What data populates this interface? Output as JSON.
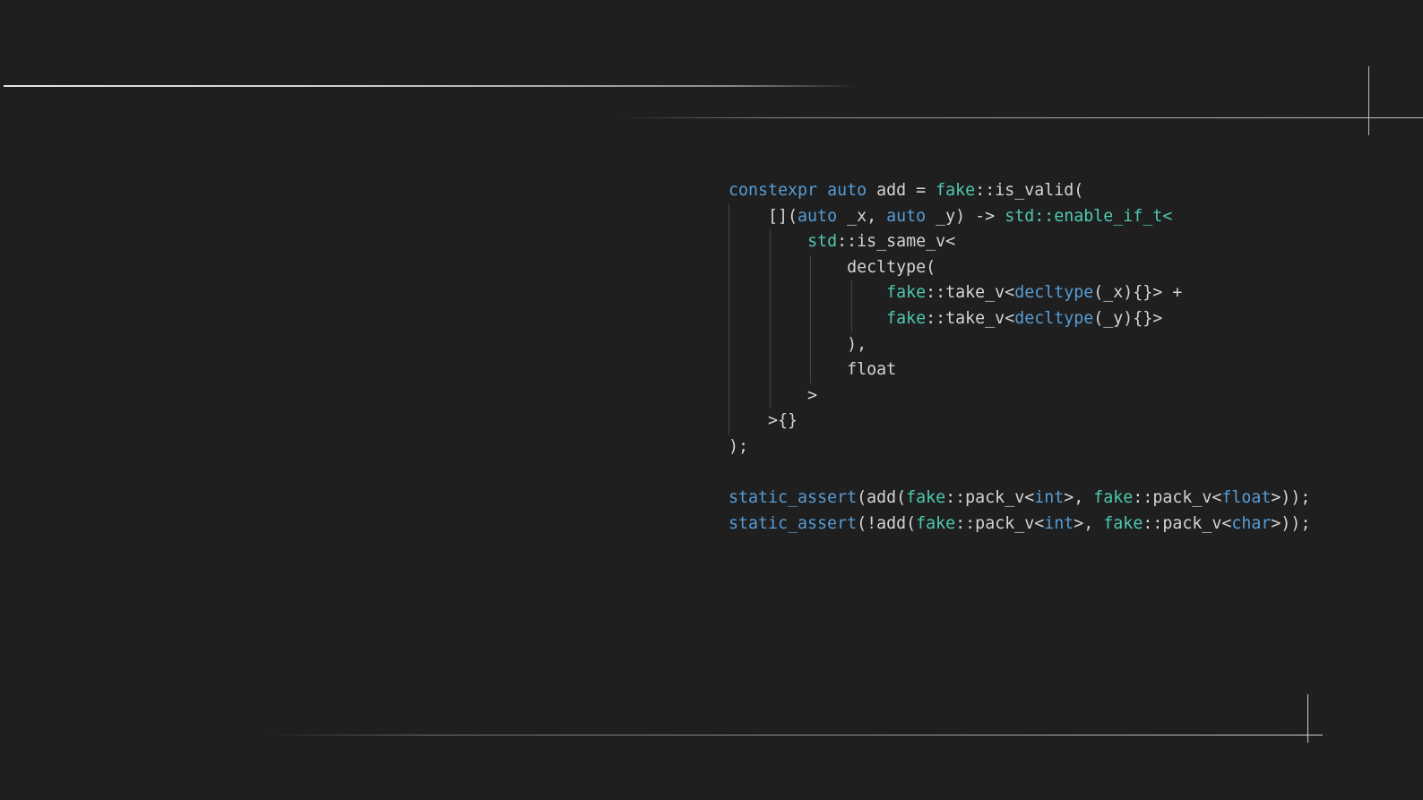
{
  "code_lines": [
    [
      {
        "t": "constexpr",
        "c": "kw"
      },
      {
        "t": " ",
        "c": "pl"
      },
      {
        "t": "auto",
        "c": "kw"
      },
      {
        "t": " add = ",
        "c": "pl"
      },
      {
        "t": "fake",
        "c": "ns"
      },
      {
        "t": "::is_valid(",
        "c": "pl"
      }
    ],
    [
      {
        "t": "    [](",
        "c": "pl"
      },
      {
        "t": "auto",
        "c": "kw"
      },
      {
        "t": " _x, ",
        "c": "pl"
      },
      {
        "t": "auto",
        "c": "kw"
      },
      {
        "t": " _y) -> ",
        "c": "pl"
      },
      {
        "t": "std::enable_if_t<",
        "c": "ns"
      }
    ],
    [
      {
        "t": "        ",
        "c": "pl"
      },
      {
        "t": "std",
        "c": "ns"
      },
      {
        "t": "::is_same_v<",
        "c": "pl"
      }
    ],
    [
      {
        "t": "            decltype(",
        "c": "pl"
      }
    ],
    [
      {
        "t": "                ",
        "c": "pl"
      },
      {
        "t": "fake",
        "c": "ns"
      },
      {
        "t": "::take_v<",
        "c": "pl"
      },
      {
        "t": "decltype",
        "c": "kw"
      },
      {
        "t": "(_x){}> +",
        "c": "pl"
      }
    ],
    [
      {
        "t": "                ",
        "c": "pl"
      },
      {
        "t": "fake",
        "c": "ns"
      },
      {
        "t": "::take_v<",
        "c": "pl"
      },
      {
        "t": "decltype",
        "c": "kw"
      },
      {
        "t": "(_y){}>",
        "c": "pl"
      }
    ],
    [
      {
        "t": "            ),",
        "c": "pl"
      }
    ],
    [
      {
        "t": "            float",
        "c": "pl"
      }
    ],
    [
      {
        "t": "        >",
        "c": "pl"
      }
    ],
    [
      {
        "t": "    >{}",
        "c": "pl"
      }
    ],
    [
      {
        "t": ");",
        "c": "pl"
      }
    ],
    [
      {
        "t": "",
        "c": "pl"
      }
    ],
    [
      {
        "t": "static_assert",
        "c": "kw"
      },
      {
        "t": "(add(",
        "c": "pl"
      },
      {
        "t": "fake",
        "c": "ns"
      },
      {
        "t": "::pack_v<",
        "c": "pl"
      },
      {
        "t": "int",
        "c": "kw"
      },
      {
        "t": ">, ",
        "c": "pl"
      },
      {
        "t": "fake",
        "c": "ns"
      },
      {
        "t": "::pack_v<",
        "c": "pl"
      },
      {
        "t": "float",
        "c": "kw"
      },
      {
        "t": ">));",
        "c": "pl"
      }
    ],
    [
      {
        "t": "static_assert",
        "c": "kw"
      },
      {
        "t": "(!add(",
        "c": "pl"
      },
      {
        "t": "fake",
        "c": "ns"
      },
      {
        "t": "::pack_v<",
        "c": "pl"
      },
      {
        "t": "int",
        "c": "kw"
      },
      {
        "t": ">, ",
        "c": "pl"
      },
      {
        "t": "fake",
        "c": "ns"
      },
      {
        "t": "::pack_v<",
        "c": "pl"
      },
      {
        "t": "char",
        "c": "kw"
      },
      {
        "t": ">));",
        "c": "pl"
      }
    ]
  ],
  "colors": {
    "background": "#1f1f1f",
    "keyword": "#569cd6",
    "namespace": "#4ec9b0",
    "plain": "#d4d4d4",
    "guide": "#454545"
  }
}
